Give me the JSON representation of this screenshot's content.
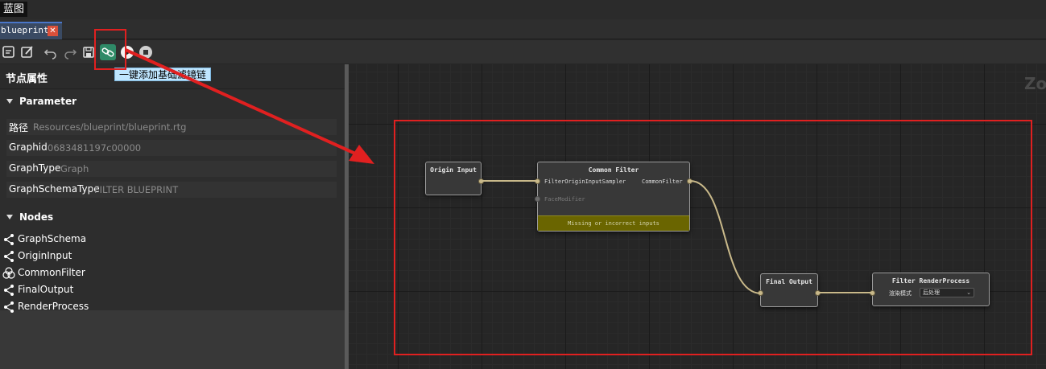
{
  "window": {
    "title": "蓝图"
  },
  "tab": {
    "label": "blueprint",
    "close_glyph": "✕"
  },
  "toolbar": {
    "buttons": [
      "notes-icon",
      "edit-icon",
      "undo-icon",
      "redo-icon",
      "save-icon",
      "link-icon",
      "play-icon",
      "stop-icon"
    ],
    "tooltip": "一键添加基础滤镜链"
  },
  "panel": {
    "title": "节点属性",
    "parameter_section": {
      "label": "Parameter",
      "rows": [
        {
          "key": "路径",
          "value": "Resources/blueprint/blueprint.rtg"
        },
        {
          "key": "Graphid",
          "value": "0683481197c00000"
        },
        {
          "key": "GraphType",
          "value": "Graph"
        },
        {
          "key": "GraphSchemaType",
          "value": "FILTER BLUEPRINT"
        }
      ]
    },
    "nodes_section": {
      "label": "Nodes",
      "items": [
        {
          "label": "GraphSchema",
          "icon": "share-icon"
        },
        {
          "label": "OriginInput",
          "icon": "share-icon"
        },
        {
          "label": "CommonFilter",
          "icon": "filter-icon"
        },
        {
          "label": "FinalOutput",
          "icon": "share-icon"
        },
        {
          "label": "RenderProcess",
          "icon": "share-icon"
        }
      ]
    }
  },
  "canvas": {
    "zoom_text": "Zo",
    "nodes": {
      "origin_input": {
        "title": "Origin Input"
      },
      "common_filter": {
        "title": "Common Filter",
        "input_1": "FilterOriginInputSampler",
        "input_2": "FaceModifier",
        "output": "CommonFilter",
        "warning": "Missing or incorrect inputs"
      },
      "final_output": {
        "title": "Final Output"
      },
      "render_process": {
        "title": "Filter RenderProcess",
        "field_label": "渲染模式",
        "field_value": "后处理"
      }
    },
    "colors": {
      "wire": "#c9b98a",
      "annotation": "#e02020",
      "warning": "#6a6500"
    }
  }
}
